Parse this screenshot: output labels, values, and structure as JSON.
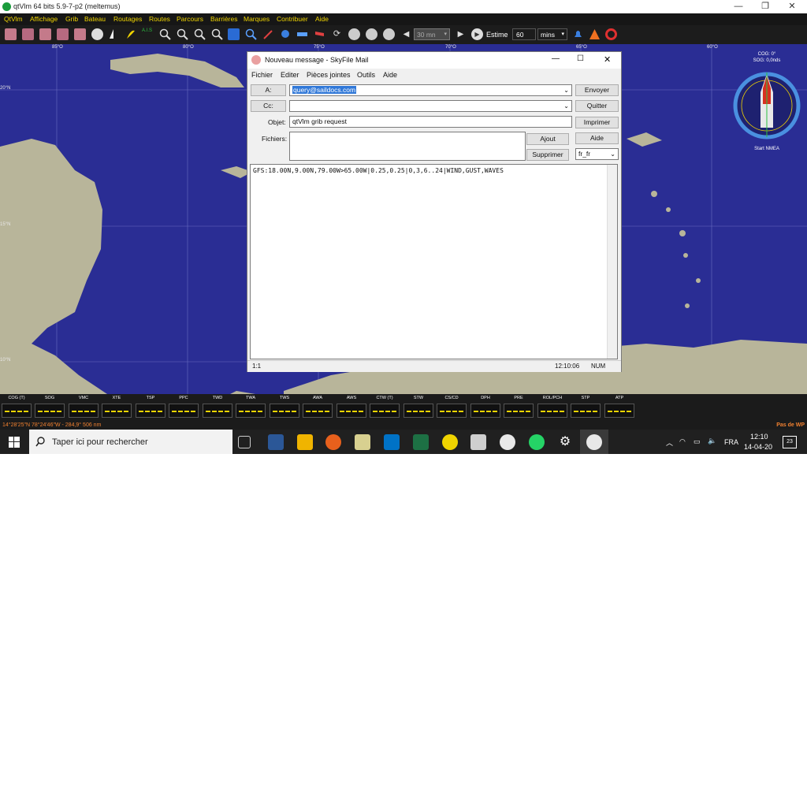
{
  "window": {
    "title": "qtVlm 64 bits 5.9-7-p2 (meltemus)",
    "controls": [
      "—",
      "❐",
      "✕"
    ]
  },
  "menu": [
    "QtVlm",
    "Affichage",
    "Grib",
    "Bateau",
    "Routages",
    "Routes",
    "Parcours",
    "Barrières",
    "Marques",
    "Contribuer",
    "Aide"
  ],
  "toolbar": {
    "step_value": "30 mn",
    "estime_label": "Estime",
    "estime_value": "60",
    "estime_unit": "mins"
  },
  "map": {
    "longitudes": [
      "85°O",
      "80°O",
      "75°O",
      "70°O",
      "65°O",
      "60°O"
    ],
    "latitudes": [
      "20°N",
      "15°N",
      "10°N"
    ],
    "compass": {
      "cog": "COG: 0°",
      "sog": "SOG: 0,0nds",
      "status": "Start NMEA"
    }
  },
  "instruments": [
    "COG (T)",
    "SOG",
    "VMC",
    "XTE",
    "TSP",
    "PPC",
    "TWD",
    "TWA",
    "TWS",
    "AWA",
    "AWS",
    "CTW (T)",
    "STW",
    "CS/CD",
    "DPH",
    "PRE",
    "ROL/PCH",
    "STP",
    "ATP"
  ],
  "status": {
    "position": "14°28'25\"N 78°24'46\"W - 284,9° 506 nm",
    "right": "Pas de WP"
  },
  "dialog": {
    "title": "Nouveau message - SkyFile Mail",
    "menu": [
      "Fichier",
      "Editer",
      "Pièces jointes",
      "Outils",
      "Aide"
    ],
    "to_label": "A:",
    "to_value": "query@saildocs.com",
    "cc_label": "Cc:",
    "cc_value": "",
    "subject_label": "Objet:",
    "subject_value": "qtVlm grib request",
    "files_label": "Fichiers:",
    "buttons": {
      "send": "Envoyer",
      "quit": "Quitter",
      "print": "Imprimer",
      "help": "Aide",
      "add": "Ajout",
      "remove": "Supprimer"
    },
    "language": "fr_fr",
    "body": "GFS:18.00N,9.00N,79.00W>65.00W|0.25,0.25|0,3,6..24|WIND,GUST,WAVES",
    "status_pos": "1:1",
    "status_time": "12:10:06",
    "status_num": "NUM"
  },
  "taskbar": {
    "search_placeholder": "Taper ici pour rechercher",
    "lang": "FRA",
    "time": "12:10",
    "date": "14-04-20",
    "notifications": "23"
  }
}
